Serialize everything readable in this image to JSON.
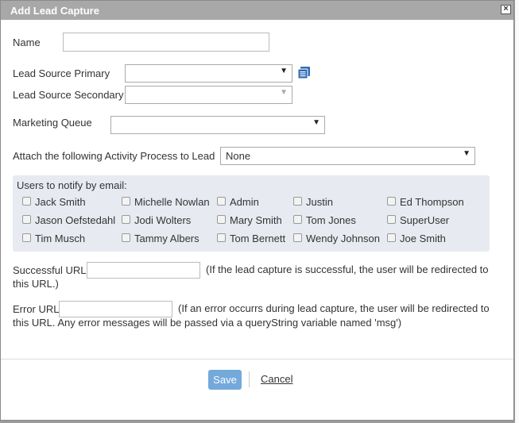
{
  "dialog": {
    "title": "Add Lead Capture",
    "close_glyph": "×"
  },
  "form": {
    "name_label": "Name",
    "name_value": "",
    "lead_source_primary_label": "Lead Source Primary",
    "lead_source_primary_value": "",
    "lead_source_secondary_label": "Lead Source Secondary",
    "lead_source_secondary_value": "",
    "marketing_queue_label": "Marketing Queue",
    "marketing_queue_value": "",
    "activity_process_label": "Attach the following Activity Process to Lead",
    "activity_process_value": "None",
    "dropdown_arrow": "▼"
  },
  "notify": {
    "title": "Users to notify by email:",
    "users": [
      "Jack Smith",
      "Michelle Nowlan",
      "Admin",
      "Justin",
      "Ed Thompson",
      "Jason Oefstedahl",
      "Jodi Wolters",
      "Mary Smith",
      "Tom Jones",
      "SuperUser",
      "Tim Musch",
      "Tammy Albers",
      "Tom Bernett",
      "Wendy Johnson",
      "Joe Smith"
    ]
  },
  "urls": {
    "success_label": "Successful URL",
    "success_value": "",
    "success_note_line1": "(If the lead capture is successful, the user will be redirected to",
    "success_note_line2": "this URL.)",
    "error_label": "Error URL",
    "error_value": "",
    "error_note_line1": "(If an error occurrs during lead capture, the user will be redirected to",
    "error_note_line2": "this URL. Any error messages will be passed via a queryString variable named 'msg')"
  },
  "actions": {
    "save_label": "Save",
    "cancel_label": "Cancel"
  },
  "colors": {
    "titlebar": "#a8a8a8",
    "notify_bg": "#e7ebf1",
    "save_button": "#5b9bd5",
    "icon_blue": "#2f6db5"
  }
}
